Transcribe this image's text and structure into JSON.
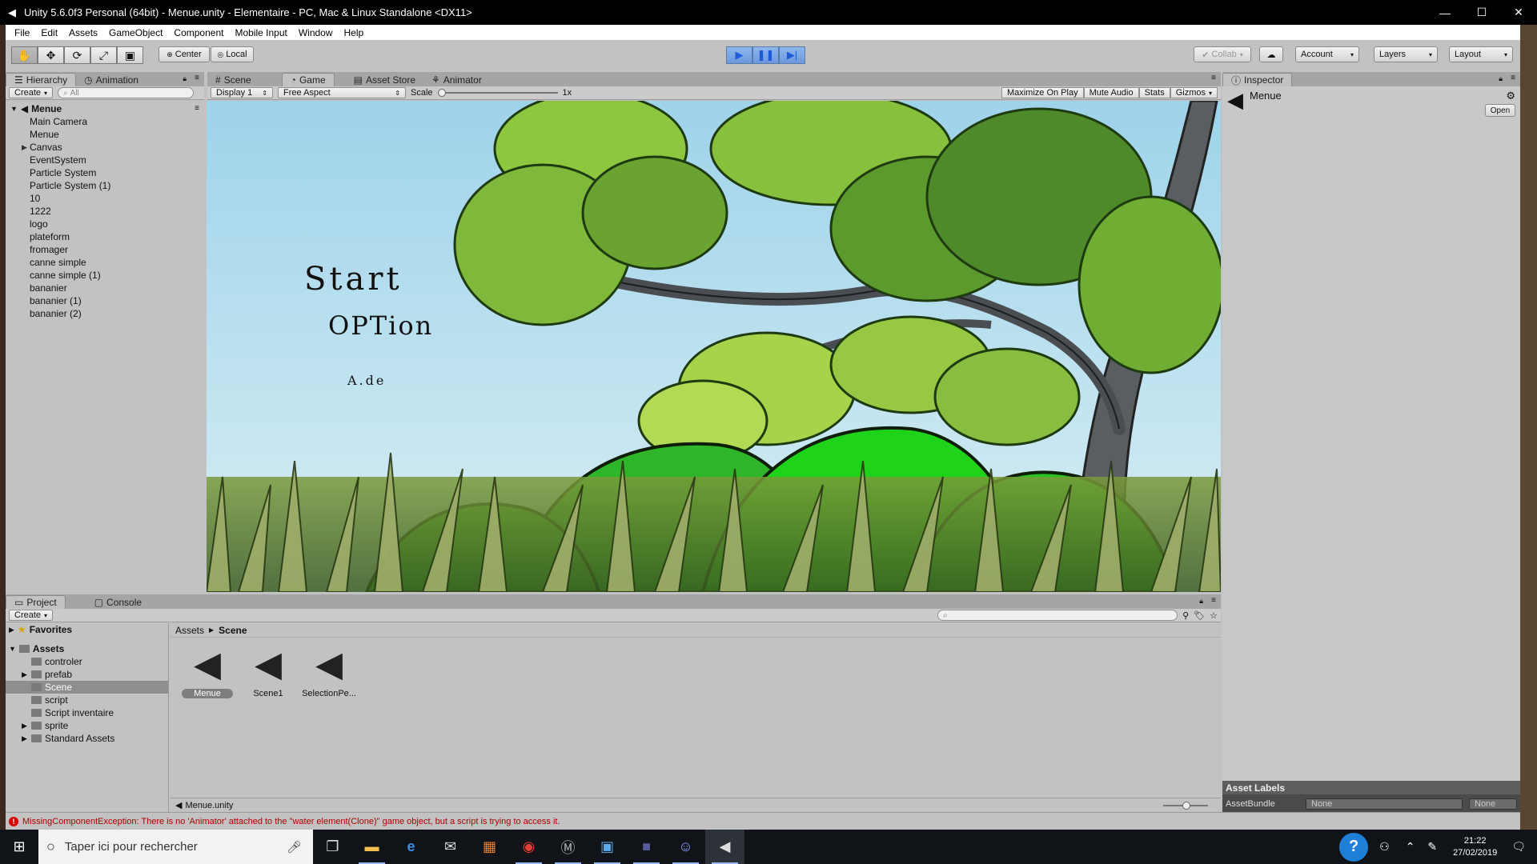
{
  "window": {
    "title": "Unity 5.6.0f3 Personal (64bit) - Menue.unity - Elementaire - PC, Mac & Linux Standalone <DX11>",
    "minimize": "—",
    "maximize": "☐",
    "close": "✕"
  },
  "menu": [
    "File",
    "Edit",
    "Assets",
    "GameObject",
    "Component",
    "Mobile Input",
    "Window",
    "Help"
  ],
  "toolbar": {
    "pivot_label": "Center",
    "space_label": "Local",
    "collab_label": "Collab",
    "account_label": "Account",
    "layers_label": "Layers",
    "layout_label": "Layout"
  },
  "hierarchy": {
    "tab_label": "Hierarchy",
    "tab2_label": "Animation",
    "create_label": "Create",
    "search_placeholder": "All",
    "scene_name": "Menue",
    "items": [
      {
        "label": "Main Camera",
        "expandable": false
      },
      {
        "label": "Menue",
        "expandable": false
      },
      {
        "label": "Canvas",
        "expandable": true
      },
      {
        "label": "EventSystem",
        "expandable": false
      },
      {
        "label": "Particle System",
        "expandable": false
      },
      {
        "label": "Particle System (1)",
        "expandable": false
      },
      {
        "label": "10",
        "expandable": false
      },
      {
        "label": "1222",
        "expandable": false
      },
      {
        "label": "logo",
        "expandable": false
      },
      {
        "label": "plateform",
        "expandable": false
      },
      {
        "label": "fromager",
        "expandable": false
      },
      {
        "label": "canne simple",
        "expandable": false
      },
      {
        "label": "canne simple (1)",
        "expandable": false
      },
      {
        "label": "bananier",
        "expandable": false
      },
      {
        "label": "bananier (1)",
        "expandable": false
      },
      {
        "label": "bananier (2)",
        "expandable": false
      }
    ]
  },
  "center_tabs": [
    "Scene",
    "Game",
    "Asset Store",
    "Animator"
  ],
  "game_bar": {
    "display": "Display 1",
    "aspect": "Free Aspect",
    "scale_label": "Scale",
    "scale_value": "1x",
    "maximize": "Maximize On Play",
    "mute": "Mute Audio",
    "stats": "Stats",
    "gizmos": "Gizmos"
  },
  "game_menu": {
    "start": "Start",
    "option": "OPTion",
    "aide": "A.de"
  },
  "inspector": {
    "tab_label": "Inspector",
    "object_name": "Menue",
    "open_label": "Open",
    "asset_labels": "Asset Labels",
    "assetbundle_label": "AssetBundle",
    "assetbundle_value": "None",
    "variant_value": "None"
  },
  "project": {
    "tab_label": "Project",
    "tab2_label": "Console",
    "create_label": "Create",
    "favorites_label": "Favorites",
    "assets_label": "Assets",
    "tree": [
      {
        "label": "controler",
        "expandable": false
      },
      {
        "label": "prefab",
        "expandable": true
      },
      {
        "label": "Scene",
        "expandable": false,
        "selected": true
      },
      {
        "label": "script",
        "expandable": false
      },
      {
        "label": "Script inventaire",
        "expandable": false
      },
      {
        "label": "sprite",
        "expandable": true
      },
      {
        "label": "Standard Assets",
        "expandable": true
      }
    ],
    "breadcrumb_root": "Assets",
    "breadcrumb_current": "Scene",
    "files": [
      "Menue",
      "Scene1",
      "SelectionPe..."
    ],
    "footer_file": "Menue.unity"
  },
  "status": {
    "message": "MissingComponentException: There is no 'Animator' attached to the \"water element(Clone)\" game object, but a script is trying to access it."
  },
  "taskbar": {
    "search_placeholder": "Taper ici pour rechercher",
    "time": "21:22",
    "date": "27/02/2019"
  }
}
